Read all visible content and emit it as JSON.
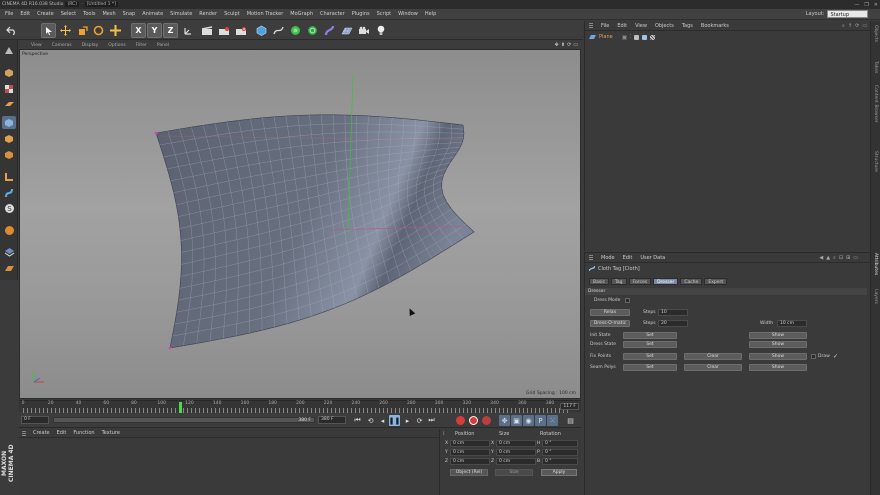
{
  "titlebar": {
    "app": "CINEMA 4D R16.038 Studio",
    "tag1": "(RC)",
    "tag2": "[Untitled 1 *]",
    "controls": [
      "—",
      "❐",
      "✕"
    ]
  },
  "menubar": {
    "items": [
      "File",
      "Edit",
      "Create",
      "Select",
      "Tools",
      "Mesh",
      "Snap",
      "Animate",
      "Simulate",
      "Render",
      "Sculpt",
      "Motion Tracker",
      "MoGraph",
      "Character",
      "Plugins",
      "Script",
      "Window",
      "Help"
    ],
    "layout_label": "Layout:",
    "layout_value": "Startup"
  },
  "toolbar": {
    "axis_x": "X",
    "axis_y": "Y",
    "axis_z": "Z"
  },
  "viewport": {
    "menu": [
      "View",
      "Cameras",
      "Display",
      "Options",
      "Filter",
      "Panel"
    ],
    "label": "Perspective",
    "grid_spacing": "Grid Spacing : 100 cm"
  },
  "timeline": {
    "ticks": [
      "0",
      "20",
      "40",
      "60",
      "80",
      "100",
      "120",
      "140",
      "160",
      "180",
      "200",
      "220",
      "240",
      "260",
      "280",
      "300",
      "320",
      "340",
      "360",
      "380"
    ],
    "current_frame": "117 F"
  },
  "transport": {
    "start_field": "0 F",
    "slider_label": "380 F",
    "end_field": "380 F"
  },
  "material": {
    "menu": [
      "Create",
      "Edit",
      "Function",
      "Texture"
    ]
  },
  "coords": {
    "headers": {
      "position": "Position",
      "size": "Size",
      "rotation": "Rotation"
    },
    "rows": [
      {
        "axis": "X",
        "pos": "0 cm",
        "size_axis": "X",
        "size": "0 cm",
        "rot_axis": "H",
        "rot": "0 °"
      },
      {
        "axis": "Y",
        "pos": "0 cm",
        "size_axis": "Y",
        "size": "0 cm",
        "rot_axis": "P",
        "rot": "0 °"
      },
      {
        "axis": "Z",
        "pos": "0 cm",
        "size_axis": "Z",
        "size": "0 cm",
        "rot_axis": "B",
        "rot": "0 °"
      }
    ],
    "mode": "Object (Rel)",
    "size_mode": "Size",
    "apply": "Apply"
  },
  "objects": {
    "menu": [
      "File",
      "Edit",
      "View",
      "Objects",
      "Tags",
      "Bookmarks"
    ],
    "items": [
      {
        "name": "Plane"
      }
    ]
  },
  "attributes": {
    "menu": [
      "Mode",
      "Edit",
      "User Data"
    ],
    "title": "Cloth Tag [Cloth]",
    "tabs": [
      "Basic",
      "Tag",
      "Forces",
      "Dresser",
      "Cache",
      "Expert"
    ],
    "active_tab": "Dresser",
    "section": "Dresser",
    "dress_mode_label": "Dress Mode",
    "relax_button": "Relax",
    "steps_label": "Steps",
    "steps_value": "10",
    "dress_o_matic_button": "Dress-O-matic",
    "steps2_value": "20",
    "width_label": "Width",
    "width_value": "10 cm",
    "init_state_label": "Init State",
    "dress_state_label": "Dress State",
    "fix_points_label": "Fix Points",
    "seam_polys_label": "Seam Polys",
    "set_label": "Set",
    "show_label": "Show",
    "clear_label": "Clear",
    "draw_label": "Draw"
  },
  "right_strip": {
    "labels": [
      "Objects",
      "Takes",
      "Content Browser",
      "Structure",
      "Attributes",
      "Layers"
    ]
  }
}
